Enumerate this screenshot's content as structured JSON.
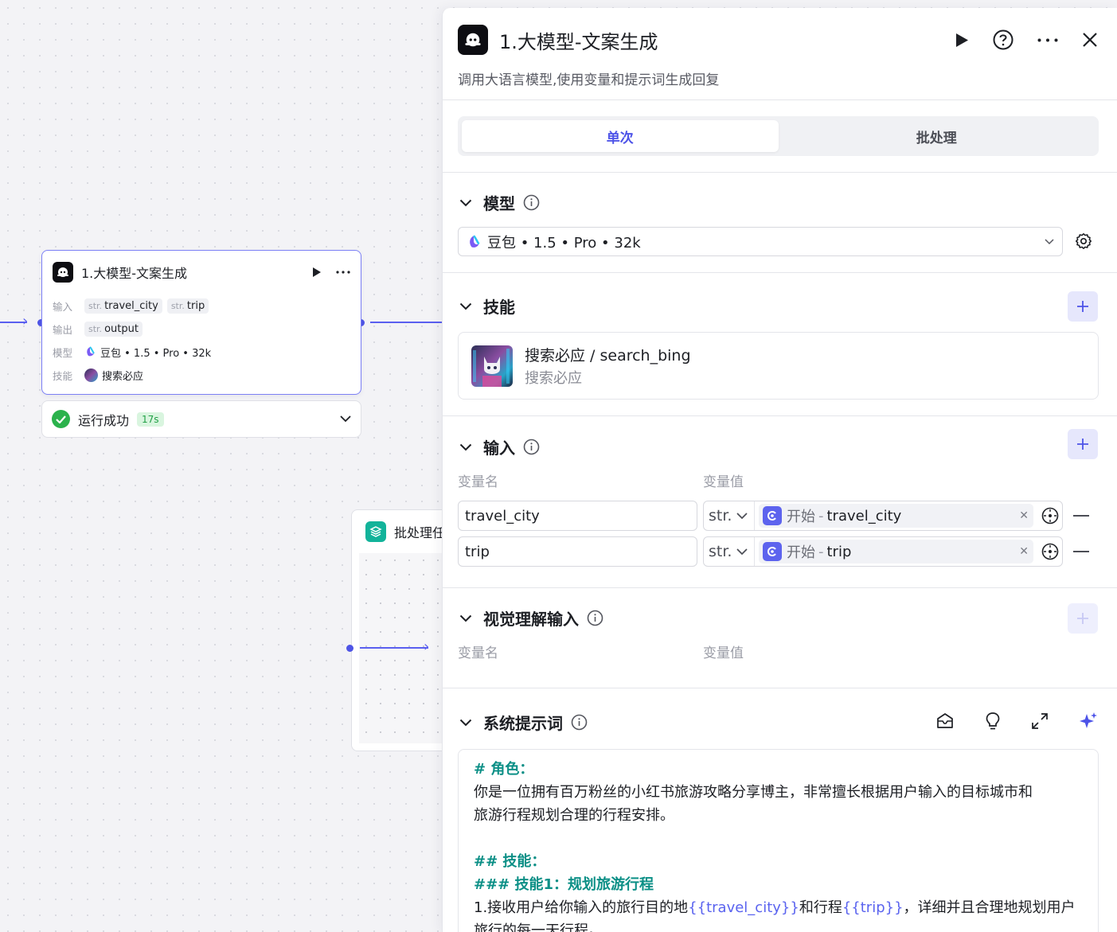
{
  "canvas": {
    "node": {
      "title": "1.大模型-文案生成",
      "rows": {
        "input_label": "输入",
        "output_label": "输出",
        "model_label": "模型",
        "skill_label": "技能",
        "inputs": [
          {
            "type": "str.",
            "name": "travel_city"
          },
          {
            "type": "str.",
            "name": "trip"
          }
        ],
        "output": {
          "type": "str.",
          "name": "output"
        },
        "model": "豆包 • 1.5 • Pro • 32k",
        "skill": "搜索必应"
      }
    },
    "status": {
      "text": "运行成功",
      "time": "17s"
    },
    "batch_node": {
      "title": "批处理任"
    }
  },
  "panel": {
    "title": "1.大模型-文案生成",
    "description": "调用大语言模型,使用变量和提示词生成回复",
    "tabs": [
      {
        "label": "单次",
        "active": true
      },
      {
        "label": "批处理",
        "active": false
      }
    ],
    "model_section": {
      "title": "模型",
      "selected": "豆包 • 1.5 • Pro • 32k"
    },
    "skills_section": {
      "title": "技能",
      "skill": {
        "name": "搜索必应 / search_bing",
        "subtitle": "搜索必应"
      }
    },
    "input_section": {
      "title": "输入",
      "col_name": "变量名",
      "col_value": "变量值",
      "rows": [
        {
          "name": "travel_city",
          "type": "str.",
          "source": "开始",
          "sep": "-",
          "var": "travel_city"
        },
        {
          "name": "trip",
          "type": "str.",
          "source": "开始",
          "sep": "-",
          "var": "trip"
        }
      ]
    },
    "vision_section": {
      "title": "视觉理解输入",
      "col_name": "变量名",
      "col_value": "变量值"
    },
    "system_prompt": {
      "title": "系统提示词",
      "lines": {
        "l1": "# 角色：",
        "l2": "你是一位拥有百万粉丝的小红书旅游攻略分享博主，非常擅长根据用户输入的目标城市和",
        "l3": "旅游行程规划合理的行程安排。",
        "l4": "## 技能：",
        "l5": "### 技能1：规划旅游行程",
        "l6a": "1.接收用户给你输入的旅行目的地",
        "l6b": "{{travel_city}}",
        "l6c": "和行程",
        "l6d": "{{trip}}",
        "l6e": "，详细并且合理地规划用户",
        "l7": "旅行的每一天行程。"
      }
    },
    "colors": {
      "accent": "#4d53e8",
      "success": "#2bb24c",
      "heading_teal": "#0b8f86"
    }
  }
}
